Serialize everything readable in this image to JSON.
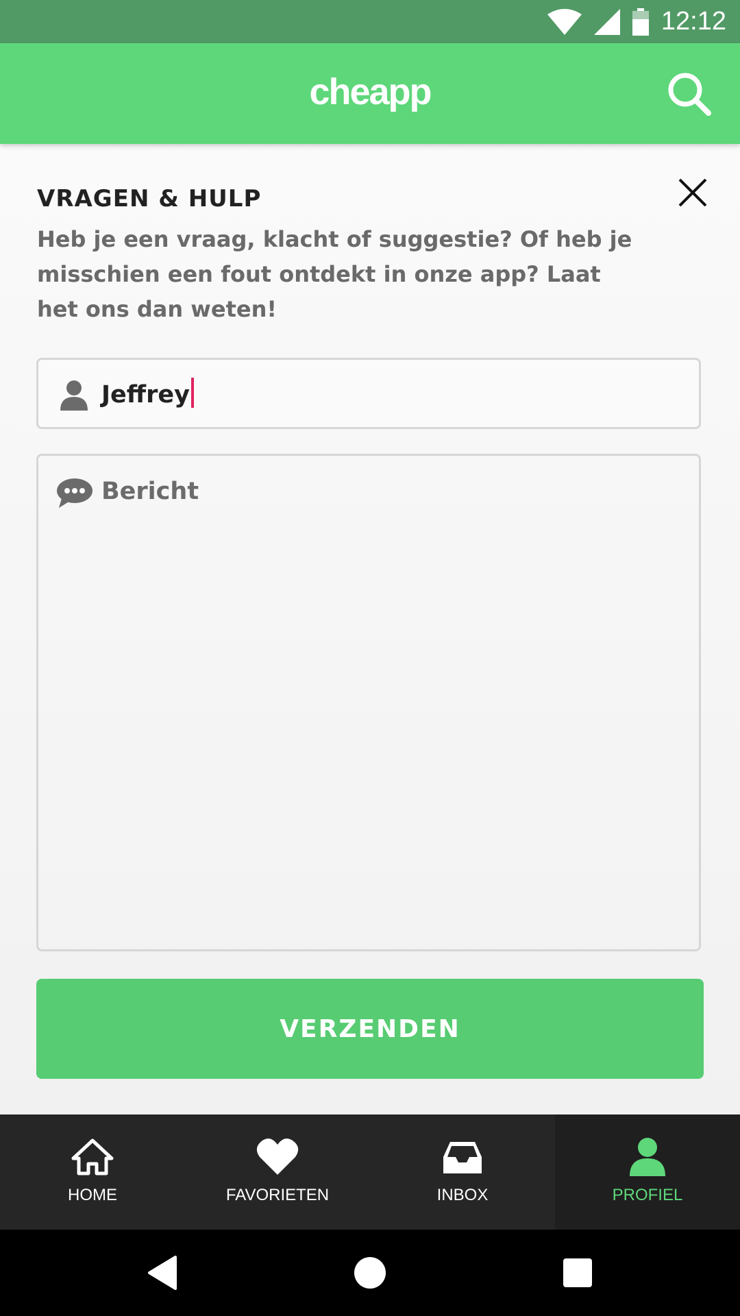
{
  "status_bar": {
    "time": "12:12"
  },
  "app_bar": {
    "logo": "cheapp"
  },
  "help": {
    "title": "VRAGEN & HULP",
    "description": "Heb je een vraag, klacht of suggestie? Of heb je misschien een fout ontdekt in onze app? Laat het ons dan weten!"
  },
  "form": {
    "name_value": "Jeffrey",
    "message_placeholder": "Bericht",
    "submit_label": "VERZENDEN"
  },
  "bottom_nav": {
    "items": [
      {
        "label": "HOME",
        "icon": "home-icon"
      },
      {
        "label": "FAVORIETEN",
        "icon": "heart-icon"
      },
      {
        "label": "INBOX",
        "icon": "inbox-icon"
      },
      {
        "label": "PROFIEL",
        "icon": "profile-icon",
        "active": true
      }
    ]
  },
  "colors": {
    "status_bar": "#519a65",
    "accent": "#5ed77a",
    "button": "#57cc72",
    "nav_bg": "#262626",
    "caret": "#e0245e"
  }
}
